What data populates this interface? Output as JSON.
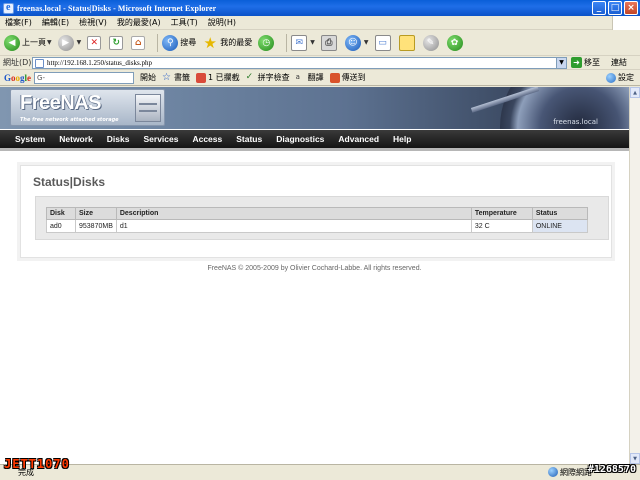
{
  "window": {
    "title": "freenas.local - Status|Disks - Microsoft Internet Explorer",
    "min": "_",
    "max": "□",
    "close": "×"
  },
  "menu": [
    "檔案(F)",
    "編輯(E)",
    "檢視(V)",
    "我的最愛(A)",
    "工具(T)",
    "說明(H)"
  ],
  "toolbar": {
    "back": "上一頁",
    "search": "搜尋",
    "favorites": "我的最愛"
  },
  "address": {
    "label": "網址(D)",
    "url": "http://192.168.1.250/status_disks.php",
    "go": "移至",
    "links": "連結"
  },
  "google_bar": {
    "logo": "Google",
    "search_value": "G-",
    "items": [
      "開始",
      "書籤",
      "1 已攔截",
      "拼字檢查",
      "翻譯",
      "傳送到"
    ],
    "settings": "設定"
  },
  "freenas": {
    "logo_text": "FreeNAS",
    "tagline": "The free network attached storage",
    "hostname": "freenas.local",
    "nav": [
      "System",
      "Network",
      "Disks",
      "Services",
      "Access",
      "Status",
      "Diagnostics",
      "Advanced",
      "Help"
    ],
    "page_title": "Status|Disks",
    "table": {
      "columns": [
        "Disk",
        "Size",
        "Description",
        "Temperature",
        "Status"
      ],
      "rows": [
        {
          "disk": "ad0",
          "size": "953870MB",
          "description": "d1",
          "temperature": "32 C",
          "status": "ONLINE"
        }
      ]
    },
    "footer": "FreeNAS © 2005-2009 by Olivier Cochard-Labbe. All rights reserved."
  },
  "statusbar": {
    "status": "完成",
    "zone": "網際網路"
  },
  "watermarks": {
    "left": "JETT1070",
    "right": "#1268570"
  }
}
